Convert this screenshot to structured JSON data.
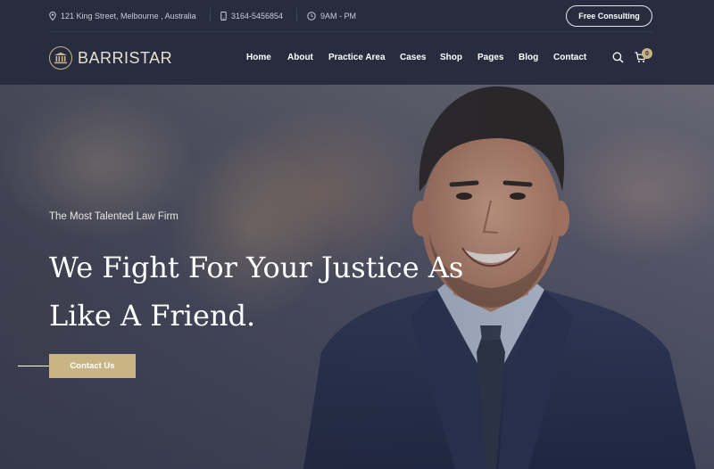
{
  "topbar": {
    "address": "121 King Street, Melbourne , Australia",
    "phone": "3164-5456854",
    "hours": "9AM - PM",
    "consult_label": "Free Consulting"
  },
  "brand": {
    "name": "BARRISTAR"
  },
  "nav": {
    "items": [
      {
        "label": "Home"
      },
      {
        "label": "About"
      },
      {
        "label": "Practice Area"
      },
      {
        "label": "Cases"
      },
      {
        "label": "Shop"
      },
      {
        "label": "Pages"
      },
      {
        "label": "Blog"
      },
      {
        "label": "Contact"
      }
    ],
    "cart_count": "0"
  },
  "hero": {
    "tagline": "The Most Talented Law Firm",
    "headline_line1": "We Fight For Your Justice As",
    "headline_line2": "Like A Friend.",
    "cta_label": "Contact Us"
  },
  "colors": {
    "navy": "#272c3f",
    "gold": "#c8b484"
  },
  "icons": [
    "location-pin-icon",
    "phone-icon",
    "clock-icon",
    "courthouse-logo-icon",
    "search-icon",
    "cart-icon"
  ]
}
